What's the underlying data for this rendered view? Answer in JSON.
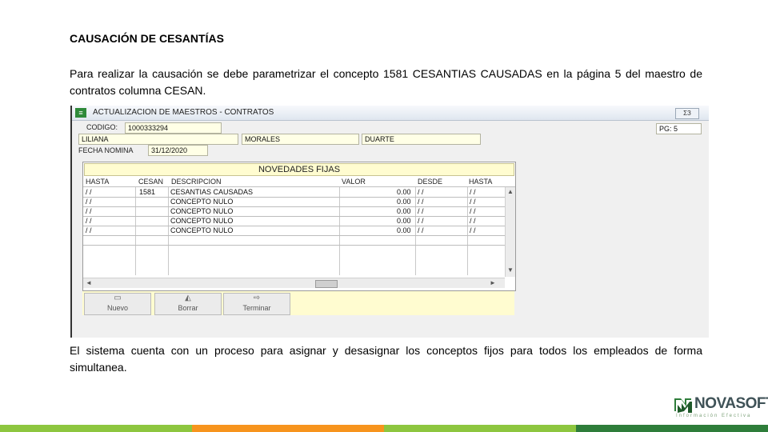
{
  "slide": {
    "title": "CAUSACIÓN DE CESANTÍAS",
    "paragraph1": "Para realizar la causación se debe parametrizar el concepto 1581 CESANTIAS CAUSADAS en la página 5 del maestro de contratos columna CESAN.",
    "paragraph2": "El sistema cuenta con un proceso para asignar y desasignar los conceptos fijos para todos los empleados de forma simultanea."
  },
  "window": {
    "title": "ACTUALIZACION DE MAESTROS - CONTRATOS",
    "close_icon_text": "ΣЗ",
    "codigo_label": "CODIGO:",
    "codigo_value": "1000333294",
    "first_name": "LILIANA",
    "last_name1": "MORALES",
    "last_name2": "DUARTE",
    "page_indicator": "PG: 5",
    "fecha_label": "FECHA NOMINA",
    "fecha_value": "31/12/2020"
  },
  "grid": {
    "caption": "NOVEDADES FIJAS",
    "columns": [
      "HASTA",
      "CESAN",
      "DESCRIPCION",
      "VALOR",
      "DESDE",
      "HASTA"
    ],
    "rows": [
      {
        "hasta": "/ /",
        "cesan": "1581",
        "descripcion": "CESANTIAS CAUSADAS",
        "valor": "0.00",
        "desde": "/ /",
        "hasta2": "/ /"
      },
      {
        "hasta": "/ /",
        "cesan": "",
        "descripcion": "CONCEPTO NULO",
        "valor": "0.00",
        "desde": "/ /",
        "hasta2": "/ /"
      },
      {
        "hasta": "/ /",
        "cesan": "",
        "descripcion": "CONCEPTO NULO",
        "valor": "0.00",
        "desde": "/ /",
        "hasta2": "/ /"
      },
      {
        "hasta": "/ /",
        "cesan": "",
        "descripcion": "CONCEPTO NULO",
        "valor": "0.00",
        "desde": "/ /",
        "hasta2": "/ /"
      },
      {
        "hasta": "/ /",
        "cesan": "",
        "descripcion": "CONCEPTO NULO",
        "valor": "0.00",
        "desde": "/ /",
        "hasta2": "/ /"
      }
    ]
  },
  "toolbar": {
    "nuevo": "Nuevo",
    "borrar": "Borrar",
    "terminar": "Terminar"
  },
  "logo": {
    "name": "NOVASOFT",
    "tagline": "Información Efectiva",
    "colors": {
      "mark": "#2e7d3a",
      "text": "#3f5257"
    }
  },
  "footer_colors": [
    "#8dc63f",
    "#f7941d",
    "#8dc63f",
    "#2e7d3a"
  ]
}
